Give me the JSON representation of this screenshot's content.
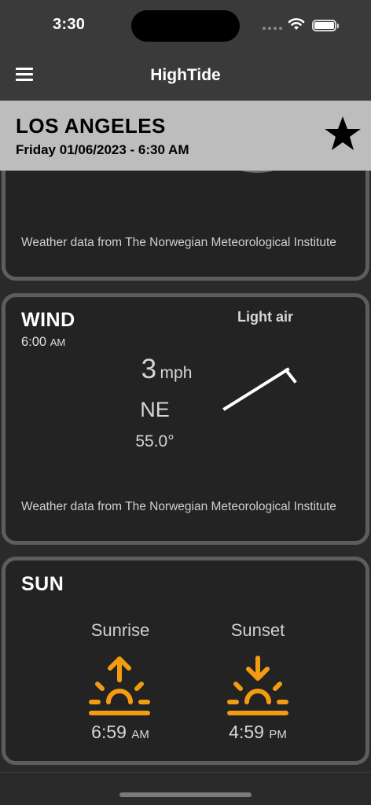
{
  "status": {
    "time": "3:30"
  },
  "nav": {
    "title": "HighTide"
  },
  "location": {
    "name": "LOS ANGELES",
    "date": "Friday 01/06/2023 - 6:30 AM"
  },
  "weather_card": {
    "attribution": "Weather data from The Norwegian Meteorological Institute"
  },
  "wind": {
    "title": "WIND",
    "time": "6:00",
    "ampm": "AM",
    "description": "Light air",
    "speed": "3",
    "unit": "mph",
    "direction": "NE",
    "degrees": "55.0°",
    "attribution": "Weather data from The Norwegian Meteorological Institute"
  },
  "sun": {
    "title": "SUN",
    "sunrise_label": "Sunrise",
    "sunset_label": "Sunset",
    "sunrise_time": "6:59",
    "sunrise_ampm": "AM",
    "sunset_time": "4:59",
    "sunset_ampm": "PM",
    "icon_color": "#f39c12"
  }
}
